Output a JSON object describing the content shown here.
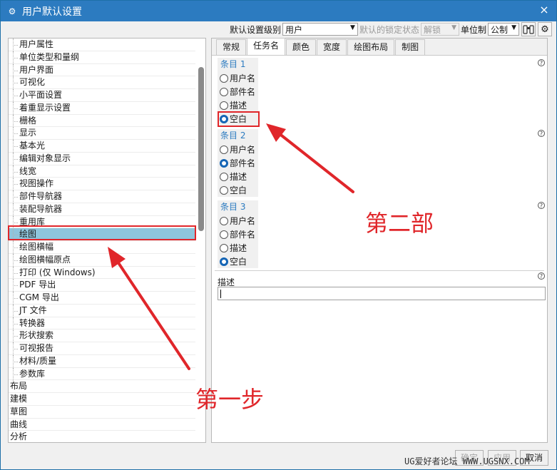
{
  "window": {
    "title": "用户默认设置",
    "close": "×",
    "title_icon": "gear-icon"
  },
  "toolbar": {
    "level_label": "默认设置级别",
    "level_value": "用户",
    "lock_label": "默认的锁定状态",
    "lock_value": "解锁",
    "unit_label": "单位制",
    "unit_value": "公制",
    "find_icon": "binoculars-icon",
    "settings_icon": "gear-icon"
  },
  "tree": [
    {
      "label": "用户属性",
      "top": false
    },
    {
      "label": "单位类型和量纲",
      "top": false
    },
    {
      "label": "用户界面",
      "top": false
    },
    {
      "label": "可视化",
      "top": false
    },
    {
      "label": "小平面设置",
      "top": false
    },
    {
      "label": "着重显示设置",
      "top": false
    },
    {
      "label": "栅格",
      "top": false
    },
    {
      "label": "显示",
      "top": false
    },
    {
      "label": "基本光",
      "top": false
    },
    {
      "label": "编辑对象显示",
      "top": false
    },
    {
      "label": "线宽",
      "top": false
    },
    {
      "label": "视图操作",
      "top": false
    },
    {
      "label": "部件导航器",
      "top": false
    },
    {
      "label": "装配导航器",
      "top": false
    },
    {
      "label": "重用库",
      "top": false
    },
    {
      "label": "绘图",
      "top": false,
      "selected": true
    },
    {
      "label": "绘图横幅",
      "top": false
    },
    {
      "label": "绘图横幅原点",
      "top": false
    },
    {
      "label": "打印 (仅 Windows)",
      "top": false
    },
    {
      "label": "PDF 导出",
      "top": false
    },
    {
      "label": "CGM 导出",
      "top": false
    },
    {
      "label": "JT 文件",
      "top": false
    },
    {
      "label": "转换器",
      "top": false
    },
    {
      "label": "形状搜索",
      "top": false
    },
    {
      "label": "可视报告",
      "top": false
    },
    {
      "label": "材料/质量",
      "top": false
    },
    {
      "label": "参数库",
      "top": false
    },
    {
      "label": "布局",
      "top": true
    },
    {
      "label": "建模",
      "top": true
    },
    {
      "label": "草图",
      "top": true
    },
    {
      "label": "曲线",
      "top": true
    },
    {
      "label": "分析",
      "top": true
    }
  ],
  "tabs": [
    "常规",
    "任务名",
    "颜色",
    "宽度",
    "绘图布局",
    "制图"
  ],
  "active_tab": 1,
  "groups": [
    {
      "title": "条目 1",
      "options": [
        "用户名",
        "部件名",
        "描述",
        "空白"
      ],
      "selected": 3
    },
    {
      "title": "条目 2",
      "options": [
        "用户名",
        "部件名",
        "描述",
        "空白"
      ],
      "selected": 1
    },
    {
      "title": "条目 3",
      "options": [
        "用户名",
        "部件名",
        "描述",
        "空白"
      ],
      "selected": 3
    }
  ],
  "description": {
    "label": "描述",
    "value": ""
  },
  "help_glyph": "?",
  "buttons": {
    "ok": "确定",
    "apply": "应用",
    "cancel": "取消"
  },
  "watermark": "UG爱好者论坛 WWW.UGSNX.COM",
  "annotations": {
    "step1": "第一步",
    "step2": "第二部"
  },
  "colors": {
    "accent": "#2c7bc0",
    "annotation": "#e0262a",
    "selection": "#8ec5dc"
  }
}
